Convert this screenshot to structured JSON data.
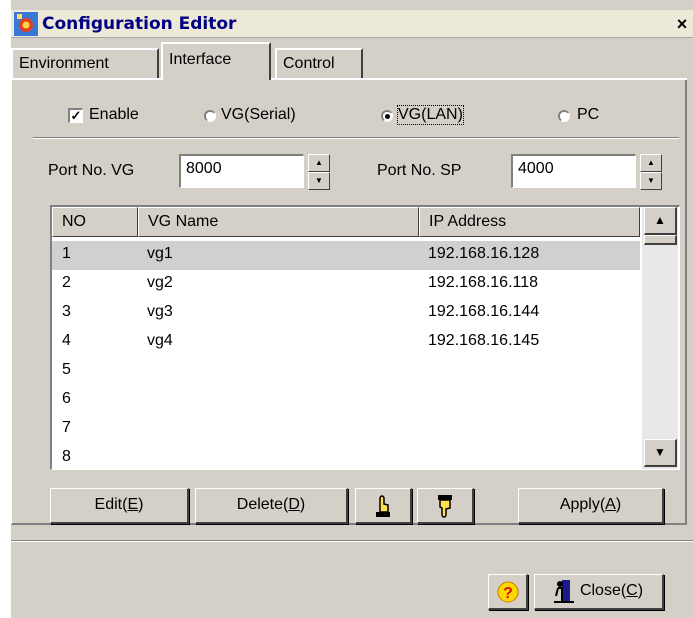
{
  "window": {
    "title": "Configuration Editor",
    "close_glyph": "×"
  },
  "tabs": [
    {
      "label": "Environment",
      "active": false
    },
    {
      "label": "Interface",
      "active": true
    },
    {
      "label": "Control",
      "active": false
    }
  ],
  "mode": {
    "enable_label": "Enable",
    "enable_checked": true,
    "options": [
      {
        "label": "VG(Serial)",
        "selected": false
      },
      {
        "label": "VG(LAN)",
        "selected": true
      },
      {
        "label": "PC",
        "selected": false
      }
    ]
  },
  "ports": {
    "vg_label": "Port No. VG",
    "vg_value": "8000",
    "sp_label": "Port No. SP",
    "sp_value": "4000"
  },
  "table": {
    "columns": [
      "NO",
      "VG Name",
      "IP Address"
    ],
    "rows": [
      {
        "no": "1",
        "name": "vg1",
        "ip": "192.168.16.128",
        "selected": true
      },
      {
        "no": "2",
        "name": "vg2",
        "ip": "192.168.16.118",
        "selected": false
      },
      {
        "no": "3",
        "name": "vg3",
        "ip": "192.168.16.144",
        "selected": false
      },
      {
        "no": "4",
        "name": "vg4",
        "ip": "192.168.16.145",
        "selected": false
      },
      {
        "no": "5",
        "name": "",
        "ip": "",
        "selected": false
      },
      {
        "no": "6",
        "name": "",
        "ip": "",
        "selected": false
      },
      {
        "no": "7",
        "name": "",
        "ip": "",
        "selected": false
      },
      {
        "no": "8",
        "name": "",
        "ip": "",
        "selected": false
      }
    ]
  },
  "actions": {
    "edit_label": "Edit(",
    "edit_key": "E",
    "delete_label": "Delete(",
    "delete_key": "D",
    "apply_label": "Apply(",
    "apply_key": "A",
    "close_label": "Close(",
    "close_key": "C",
    "paren_close": ")",
    "move_up_icon": "hand-up-icon",
    "move_down_icon": "hand-down-icon",
    "help_icon": "help-icon",
    "exit_icon": "exit-door-icon"
  }
}
